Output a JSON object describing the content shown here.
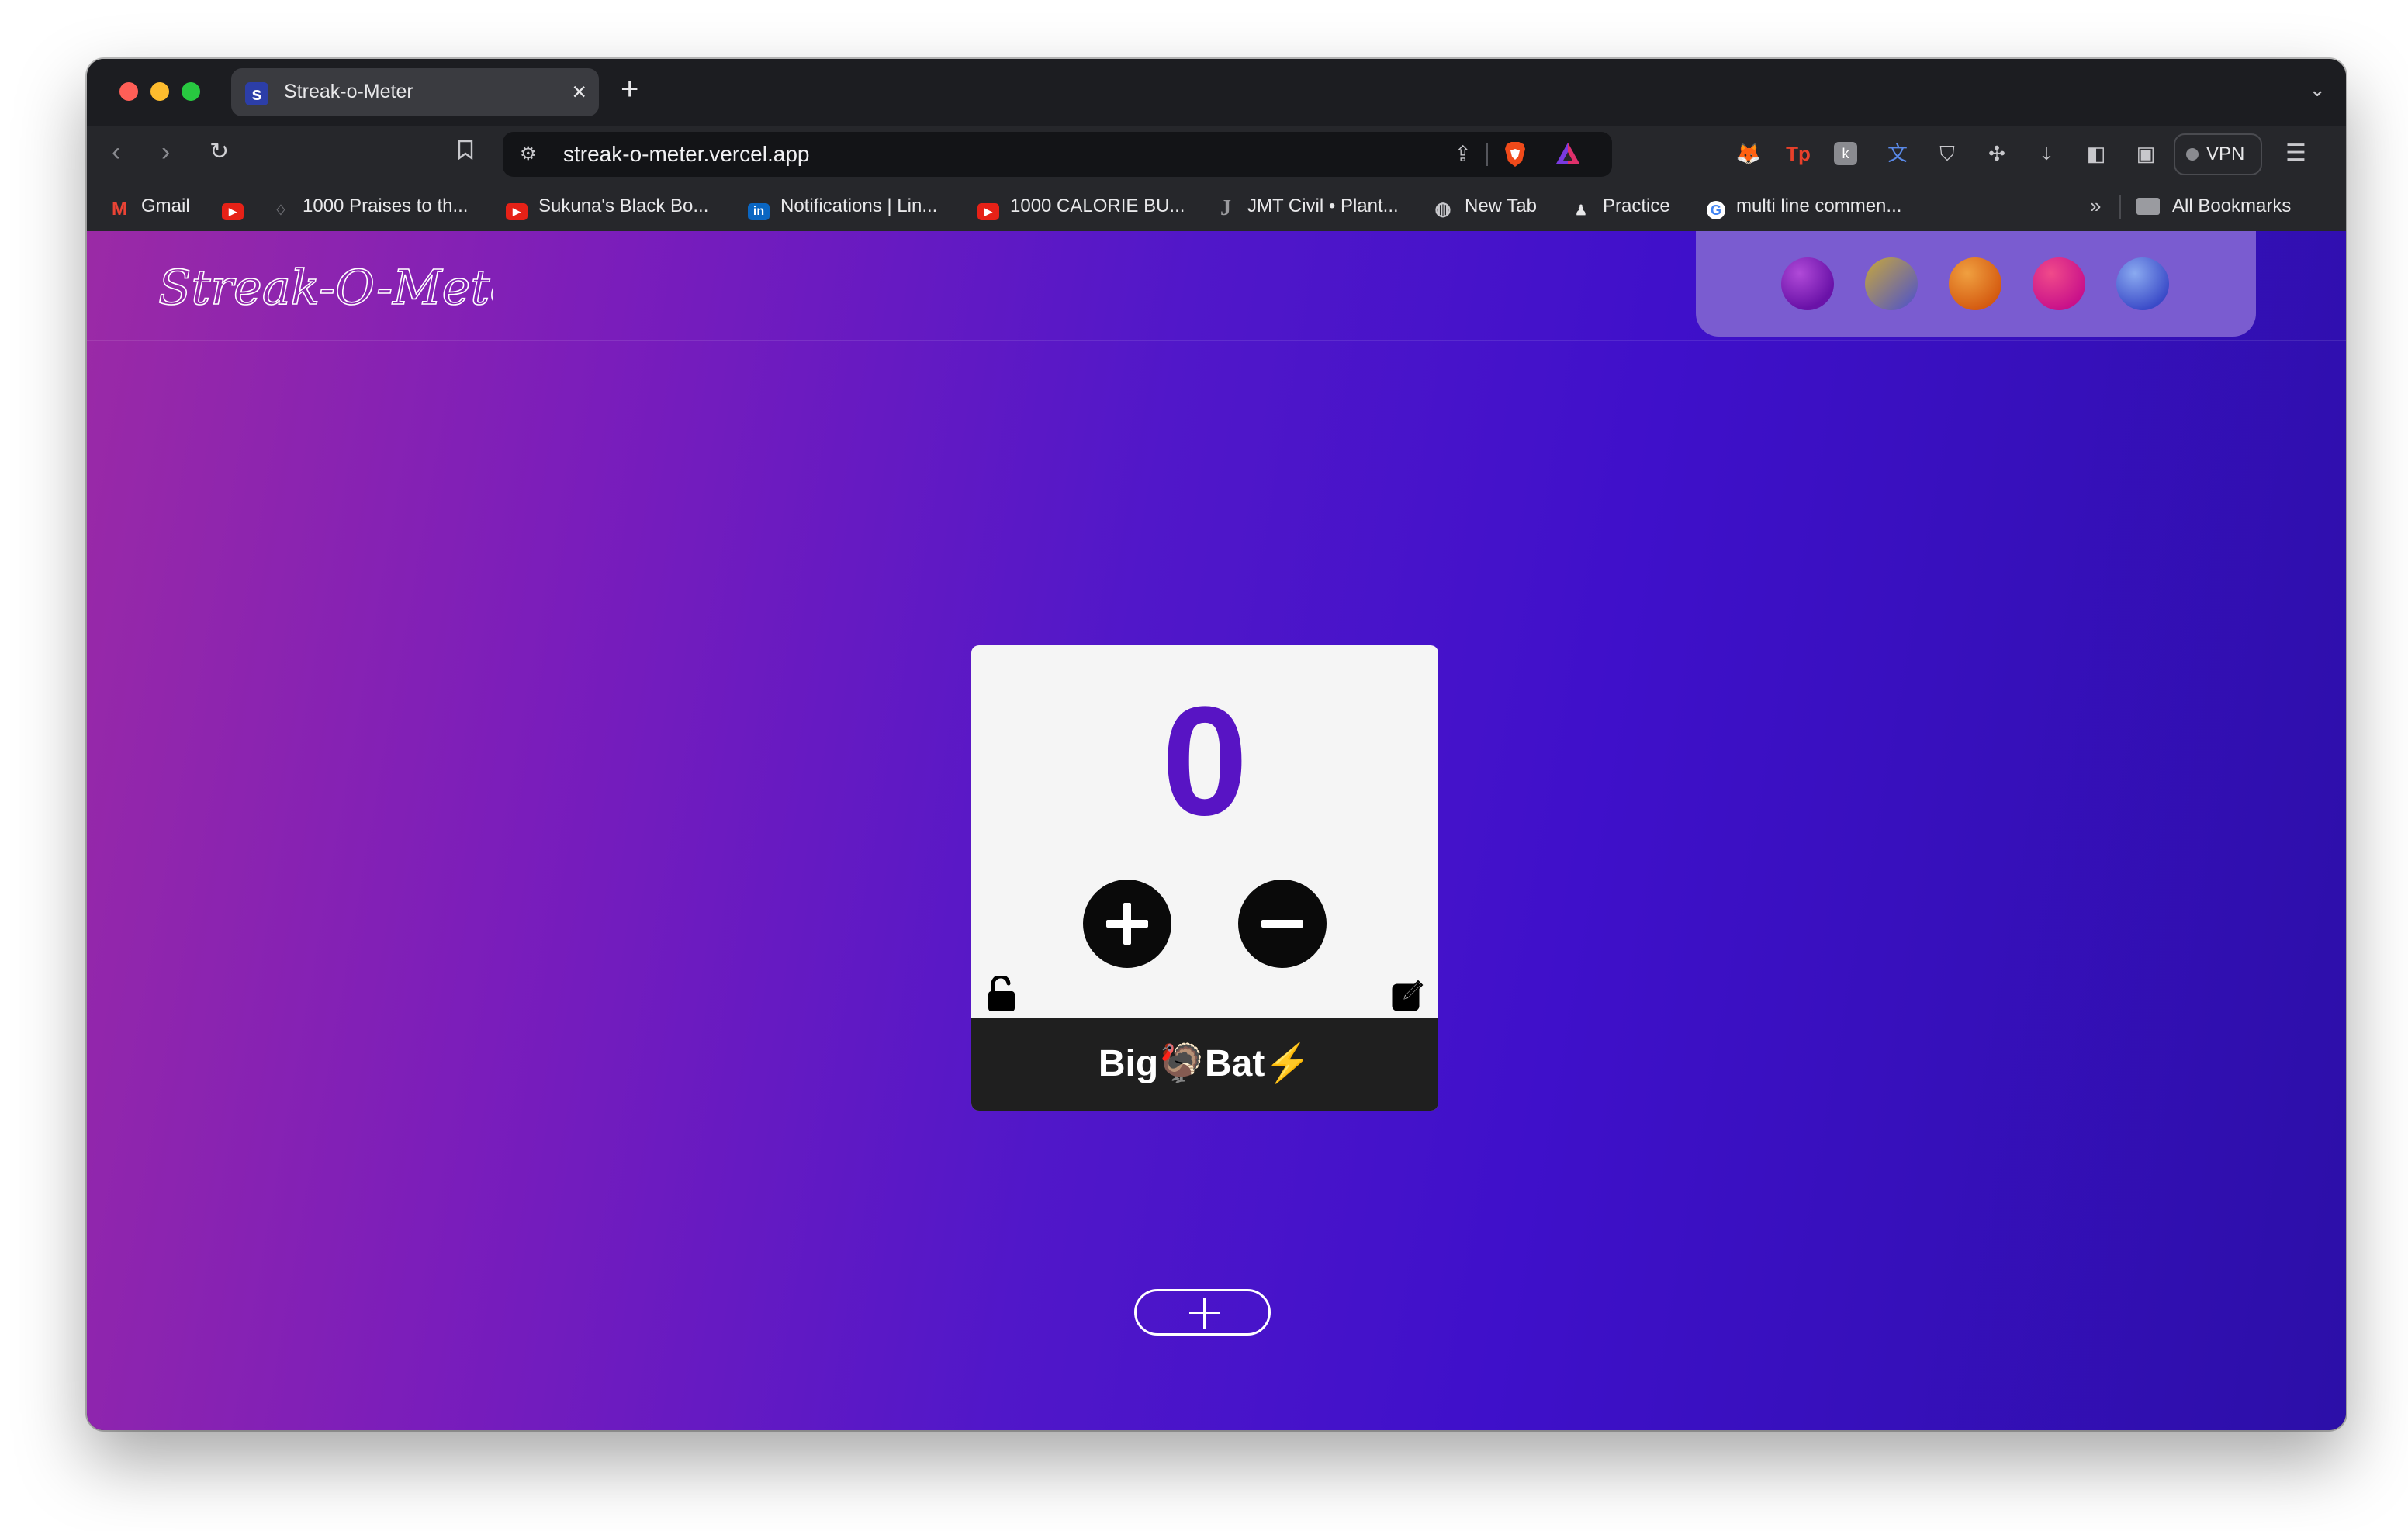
{
  "browser": {
    "tab": {
      "favicon_letter": "s",
      "title": "Streak-o-Meter"
    },
    "new_tab_glyph": "+",
    "url": "streak-o-meter.vercel.app",
    "vpn_label": "VPN",
    "bookmarks": [
      {
        "icon": "gmail-icon",
        "label": "Gmail"
      },
      {
        "icon": "youtube-icon",
        "label": ""
      },
      {
        "icon": "wreath-icon",
        "label": "1000 Praises to th..."
      },
      {
        "icon": "youtube-icon",
        "label": "Sukuna's Black Bo..."
      },
      {
        "icon": "linkedin-icon",
        "label": "Notifications | Lin..."
      },
      {
        "icon": "youtube-icon",
        "label": "1000 CALORIE BU..."
      },
      {
        "icon": "j-icon",
        "label": "JMT Civil • Plant..."
      },
      {
        "icon": "globe-icon",
        "label": "New Tab"
      },
      {
        "icon": "bell-icon",
        "label": "Practice"
      },
      {
        "icon": "google-icon",
        "label": "multi line commen..."
      }
    ],
    "bookmarks_overflow": "»",
    "all_bookmarks_label": "All Bookmarks"
  },
  "app": {
    "logo_text": "Streak-O-Meter",
    "palette": [
      {
        "name": "purple",
        "color": "#8a2ac0"
      },
      {
        "name": "gold-blue",
        "color": "#8a80a0"
      },
      {
        "name": "orange",
        "color": "#e07a20"
      },
      {
        "name": "pink",
        "color": "#e0207a"
      },
      {
        "name": "blue",
        "color": "#6a80e0"
      }
    ],
    "counter": {
      "value": "0",
      "name": "Big🦃Bat⚡",
      "accent_color": "#5814c4"
    }
  }
}
